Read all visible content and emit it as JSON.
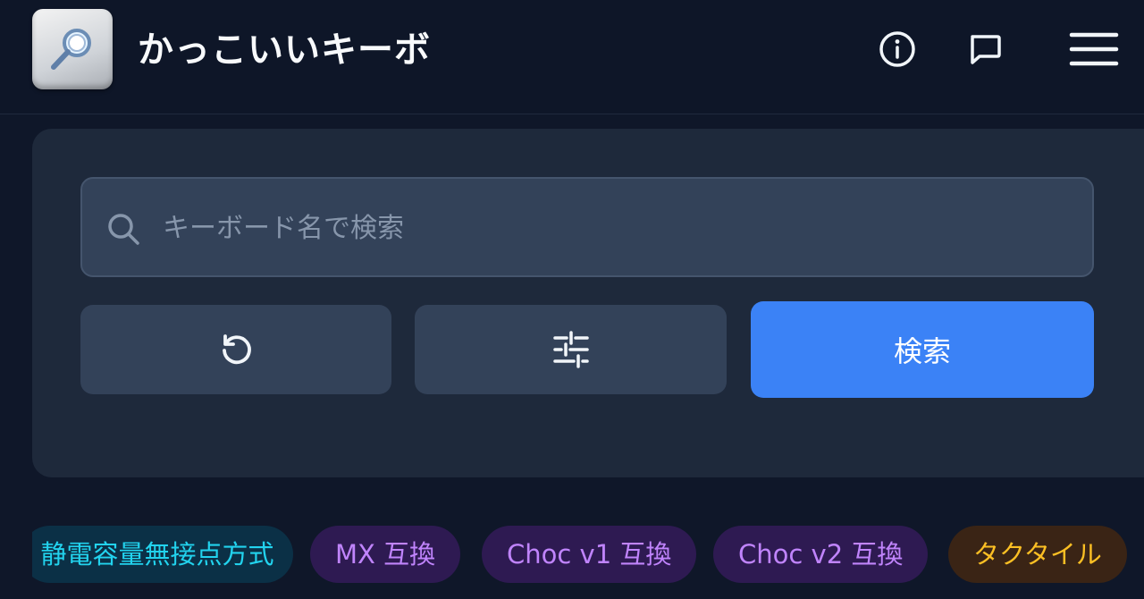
{
  "header": {
    "app_title": "かっこいいキーボ",
    "logo_icon": "magnifier-keycap-icon",
    "icons": [
      "info-icon",
      "chat-bubble-icon",
      "hamburger-menu-icon"
    ]
  },
  "search": {
    "placeholder": "キーボード名で検索",
    "value": "",
    "icon": "search-icon",
    "reset_icon": "reset-icon",
    "filter_icon": "sliders-icon",
    "submit_label": "検索"
  },
  "tags": [
    {
      "label": "静電容量無接点方式",
      "style": "cyan"
    },
    {
      "label": "MX 互換",
      "style": "purple"
    },
    {
      "label": "Choc v1 互換",
      "style": "purple"
    },
    {
      "label": "Choc v2 互換",
      "style": "purple"
    },
    {
      "label": "タクタイル",
      "style": "orange"
    }
  ],
  "colors": {
    "background": "#0f1729",
    "card": "#1e293b",
    "input": "#334259",
    "accent": "#3b82f6",
    "tag_cyan_text": "#22d3ee",
    "tag_purple_text": "#c084fc",
    "tag_orange_text": "#fbbf24"
  }
}
